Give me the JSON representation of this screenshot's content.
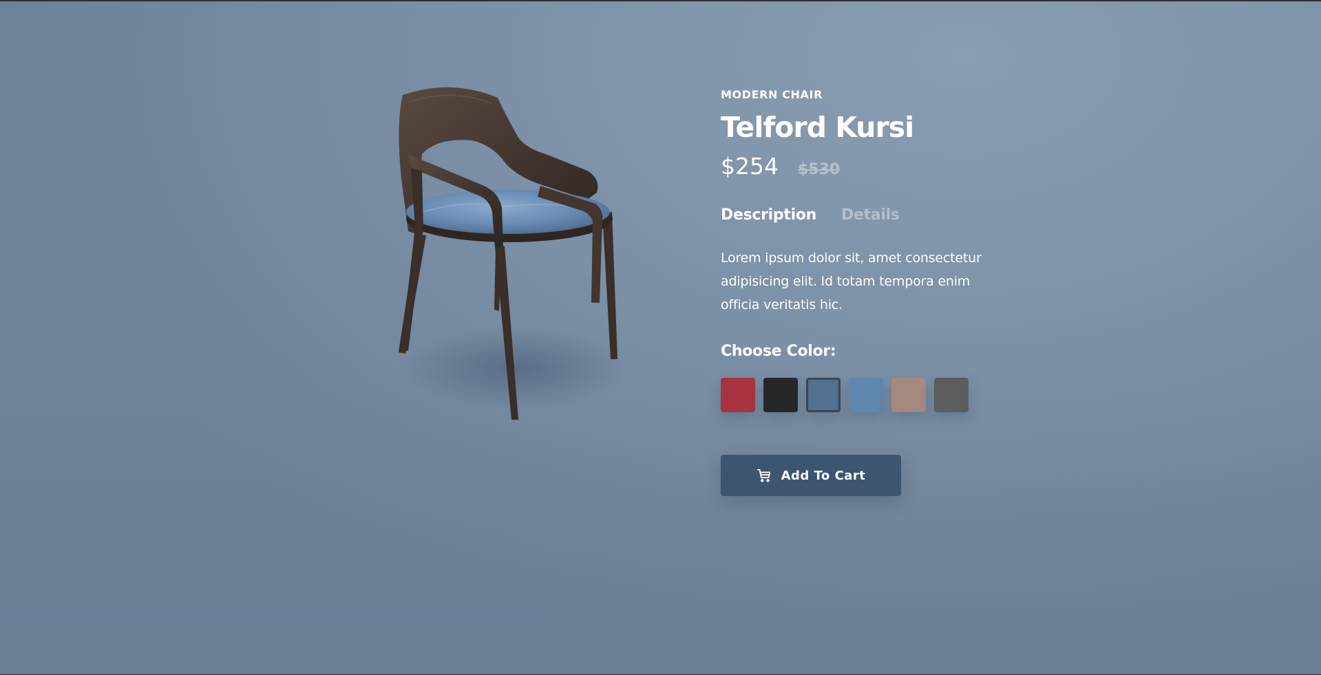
{
  "product": {
    "category": "MODERN CHAIR",
    "name": "Telford Kursi",
    "price": "$254",
    "old_price": "$530"
  },
  "tabs": [
    {
      "label": "Description",
      "active": true
    },
    {
      "label": "Details",
      "active": false
    }
  ],
  "description": "Lorem ipsum dolor sit, amet consectetur adipisicing elit. Id totam tempora enim officia veritatis hic.",
  "color_picker": {
    "label": "Choose Color:",
    "swatches": [
      {
        "name": "red",
        "color": "#a8333f",
        "selected": false
      },
      {
        "name": "black",
        "color": "#262729",
        "selected": false
      },
      {
        "name": "blue-velvet",
        "color": "#53708f",
        "selected": true
      },
      {
        "name": "light-blue",
        "color": "#5f86ad",
        "selected": false
      },
      {
        "name": "beige",
        "color": "#a4897e",
        "selected": false
      },
      {
        "name": "grey",
        "color": "#5a5e5d",
        "selected": false
      }
    ]
  },
  "cart_button": {
    "label": "Add To Cart",
    "icon": "cart-icon"
  },
  "colors": {
    "button_bg": "#3d556f",
    "text": "#ffffff",
    "muted_text": "#b3becb"
  }
}
